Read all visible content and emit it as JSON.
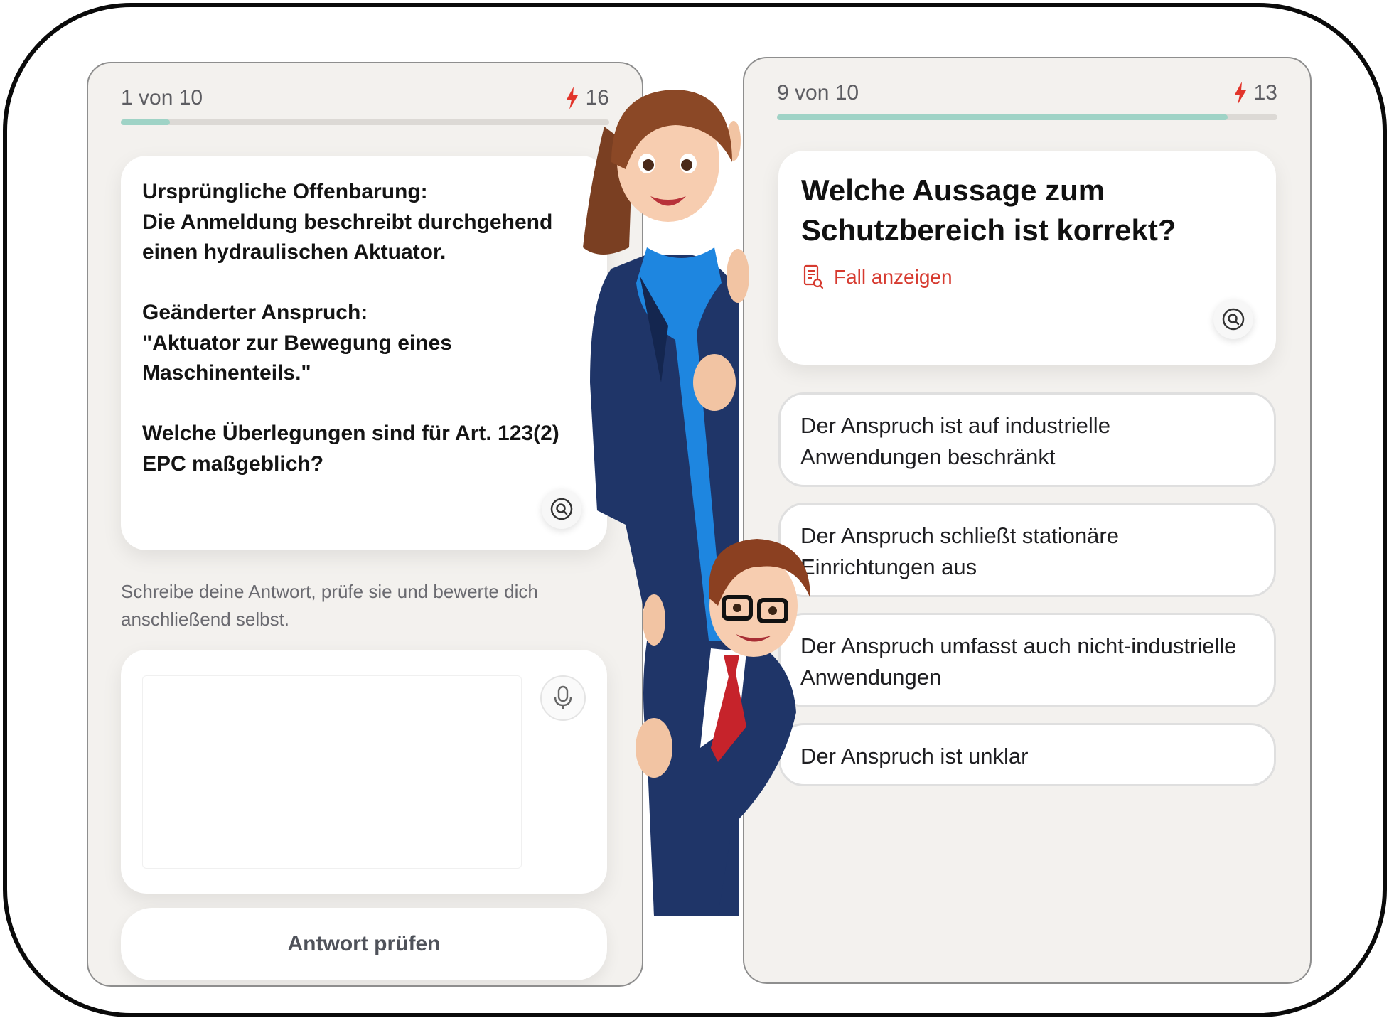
{
  "left_screen": {
    "progress_label": "1 von 10",
    "progress_fraction": 0.1,
    "streak": "16",
    "question": "Ursprüngliche Offenbarung:\nDie Anmeldung beschreibt durchgehend einen hydraulischen Aktuator.\n\nGeänderter Anspruch:\n\"Aktuator zur Bewegung eines Maschinenteils.\"\n\nWelche Überlegungen sind für Art. 123(2) EPC maßgeblich?",
    "hint": "Schreibe deine Antwort, prüfe sie und bewerte dich anschließend selbst.",
    "answer_value": "",
    "check_button": "Antwort prüfen"
  },
  "right_screen": {
    "progress_label": "9 von 10",
    "progress_fraction": 0.9,
    "streak": "13",
    "question": "Welche Aussage zum Schutzbereich ist korrekt?",
    "case_link": "Fall anzeigen",
    "options": [
      "Der Anspruch ist auf industrielle Anwendungen beschränkt",
      "Der Anspruch schließt stationäre Einrichtungen aus",
      "Der Anspruch umfasst auch nicht-industrielle Anwendungen",
      "Der Anspruch ist unklar"
    ]
  },
  "colors": {
    "accent_green": "#9fd3c6",
    "streak_red": "#e2352b",
    "link_red": "#d63a2f",
    "background": "#f3f1ee"
  },
  "icons": [
    "bolt-icon",
    "zoom-icon",
    "microphone-icon",
    "document-search-icon"
  ]
}
